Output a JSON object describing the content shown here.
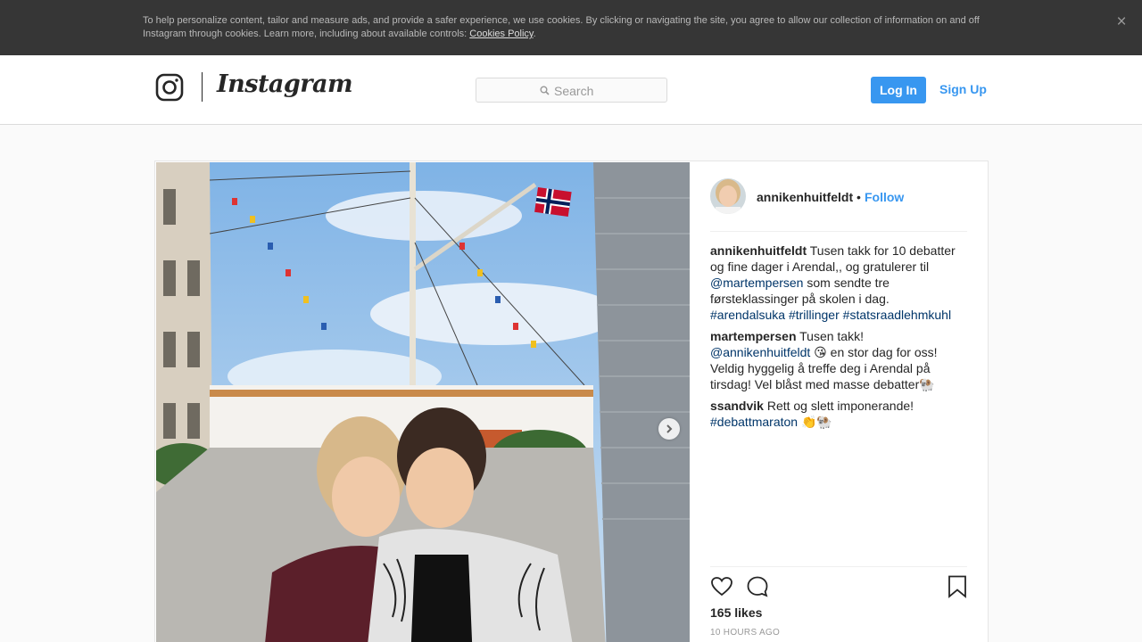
{
  "cookie_banner": {
    "text": "To help personalize content, tailor and measure ads, and provide a safer experience, we use cookies. By clicking or navigating the site, you agree to allow our collection of information on and off Instagram through cookies. Learn more, including about available controls: ",
    "link_label": "Cookies Policy",
    "link_suffix": ".",
    "close_glyph": "×"
  },
  "header": {
    "logo_text": "Instagram",
    "search_placeholder": "Search",
    "login_label": "Log In",
    "signup_label": "Sign Up",
    "accent_color": "#3897f0"
  },
  "post": {
    "author": "annikenhuitfeldt",
    "separator": "•",
    "follow_label": "Follow",
    "caption": {
      "user": "annikenhuitfeldt",
      "text_1": " Tusen takk for 10 debatter og fine dager i Arendal,, og gratulerer til ",
      "mention": "@martempersen",
      "text_2": " som sendte tre førsteklassinger på skolen i dag. ",
      "hashtags": [
        "#arendalsuka",
        "#trillinger",
        "#statsraadlehmkuhl"
      ]
    },
    "comments": [
      {
        "user": "martempersen",
        "text_1": " Tusen takk! ",
        "mention": "@annikenhuitfeldt",
        "text_2": " 😘 en stor dag for oss! Veldig hyggelig å treffe deg i Arendal på tirsdag! Vel blåst med masse debatter🐏"
      },
      {
        "user": "ssandvik",
        "text_1": " Rett og slett imponerande! ",
        "hashtag": "#debattmaraton",
        "text_2": " 👏🐏"
      }
    ],
    "likes": "165 likes",
    "timestamp": "10 HOURS AGO",
    "icons": {
      "like": "heart-icon",
      "comment": "comment-bubble-icon",
      "save": "bookmark-icon",
      "next": "chevron-right-icon"
    }
  }
}
